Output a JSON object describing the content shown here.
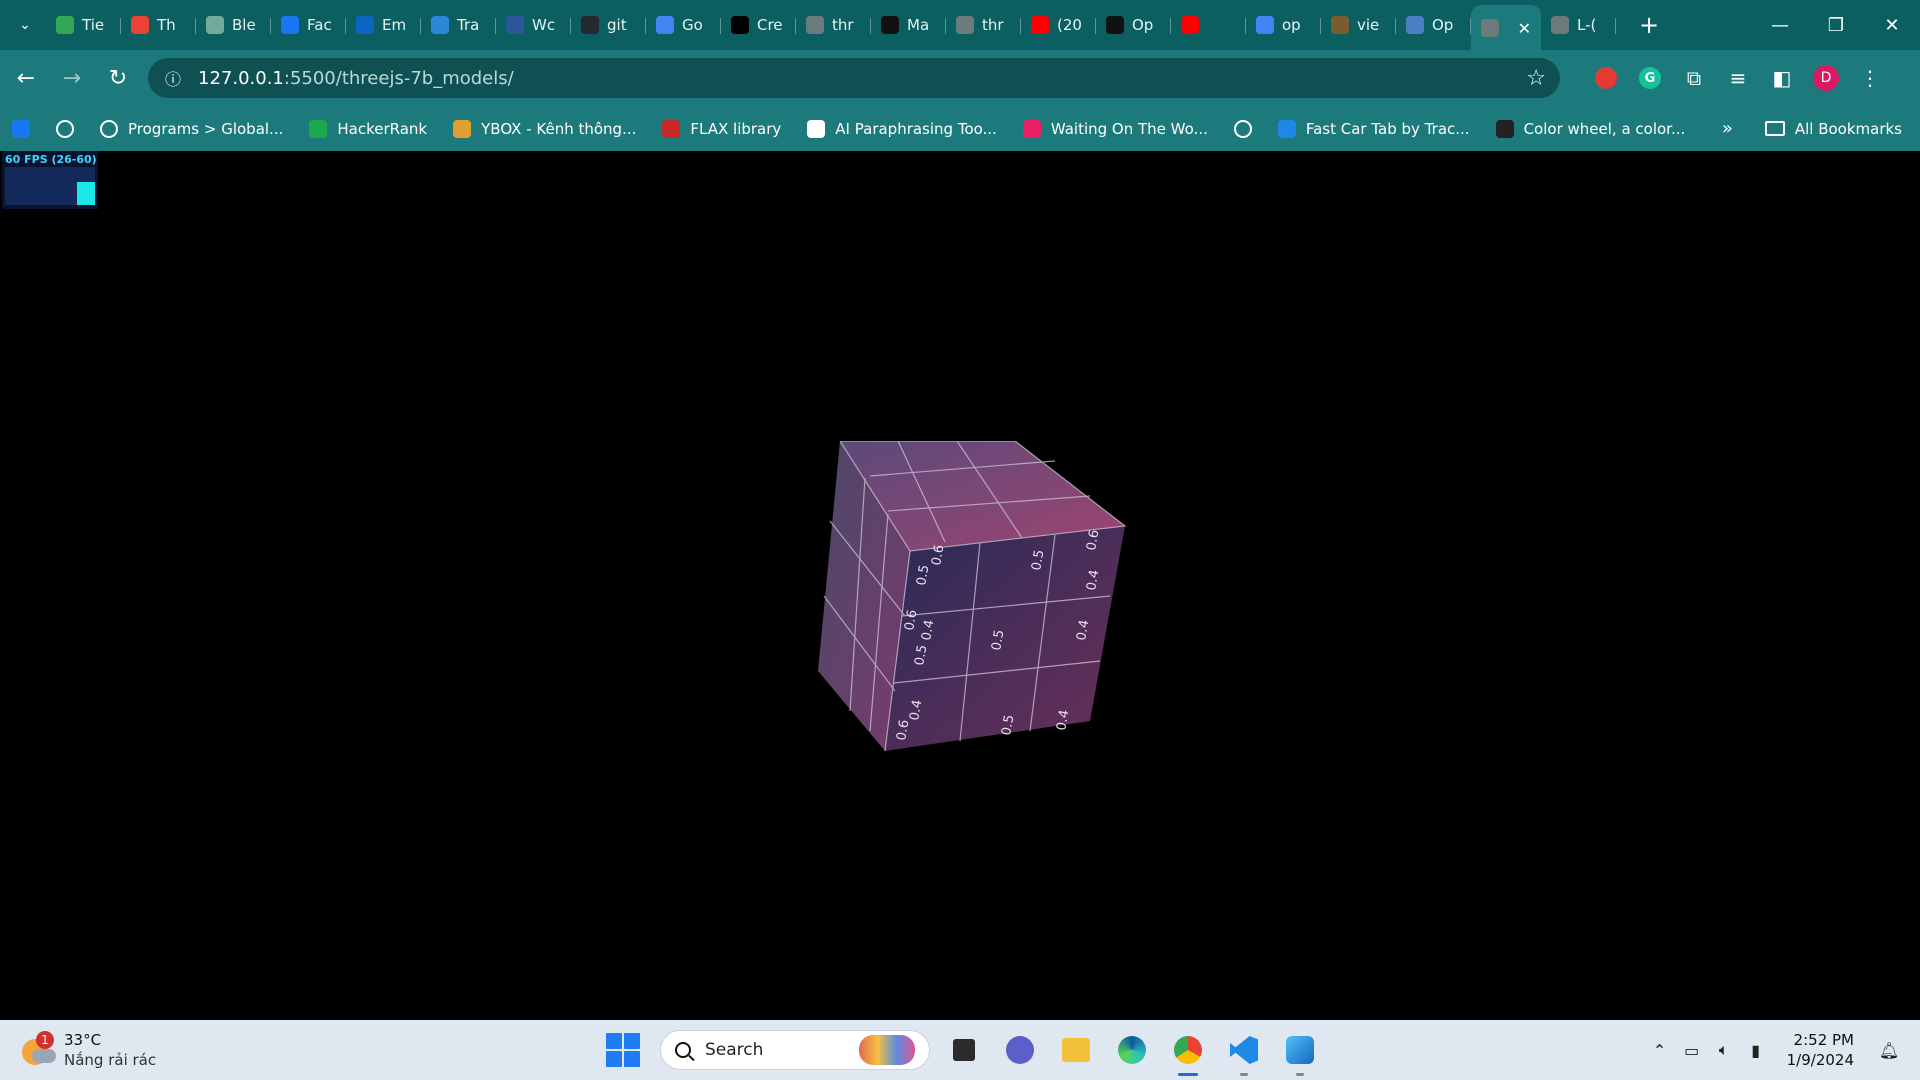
{
  "tabs": [
    {
      "title": "Tie",
      "color": "#34a853"
    },
    {
      "title": "Th",
      "color": "#ea4335"
    },
    {
      "title": "Ble",
      "color": "#74aa9c"
    },
    {
      "title": "Fac",
      "color": "#1877f2"
    },
    {
      "title": "Em",
      "color": "#0a66c2"
    },
    {
      "title": "Tra",
      "color": "#2b88d8"
    },
    {
      "title": "Wc",
      "color": "#2b579a"
    },
    {
      "title": "git",
      "color": "#24292f"
    },
    {
      "title": "Go",
      "color": "#4285f4"
    },
    {
      "title": "Cre",
      "color": "#000000"
    },
    {
      "title": "thr",
      "color": "#6b7b7b"
    },
    {
      "title": "Ma",
      "color": "#111111"
    },
    {
      "title": "thr",
      "color": "#6b7b7b"
    },
    {
      "title": "(20",
      "color": "#ff0000"
    },
    {
      "title": "Op",
      "color": "#111111"
    },
    {
      "title": "",
      "color": "#ff0000"
    },
    {
      "title": "op",
      "color": "#4285f4"
    },
    {
      "title": "vie",
      "color": "#7a5c2e"
    },
    {
      "title": "Op",
      "color": "#4a7fc1"
    },
    {
      "title": "",
      "color": "#6b7b7b"
    },
    {
      "title": "L-(",
      "color": "#6b7b7b"
    }
  ],
  "active_tab_index": 19,
  "toolbar": {
    "url_host": "127.0.0.1",
    "url_path": ":5500/threejs-7b_models/",
    "avatar_letter": "D"
  },
  "bookmarks": [
    {
      "label": "",
      "icon": "facebook-icon",
      "color": "#1877f2"
    },
    {
      "label": "",
      "icon": "globe-icon",
      "color": "#ffffff"
    },
    {
      "label": "Programs > Global...",
      "icon": "globe-icon",
      "color": "#ffffff"
    },
    {
      "label": "HackerRank",
      "icon": "hackerrank-icon",
      "color": "#1ba94c"
    },
    {
      "label": "YBOX - Kênh thông...",
      "icon": "ybox-icon",
      "color": "#e0a030"
    },
    {
      "label": "FLAX library",
      "icon": "flax-icon",
      "color": "#c62828"
    },
    {
      "label": "AI Paraphrasing Too...",
      "icon": "quill-icon",
      "color": "#ffffff"
    },
    {
      "label": "Waiting On The Wo...",
      "icon": "goodreads-icon",
      "color": "#e91e63"
    },
    {
      "label": "",
      "icon": "globe-icon",
      "color": "#ffffff"
    },
    {
      "label": "Fast Car Tab by Trac...",
      "icon": "car-icon",
      "color": "#1e88e5"
    },
    {
      "label": "Color wheel, a color...",
      "icon": "color-wheel-icon",
      "color": "#222222"
    }
  ],
  "all_bookmarks_label": "All Bookmarks",
  "fps": {
    "label": "60 FPS (26-60)",
    "level": 0.6
  },
  "cube": {
    "labels": [
      "0.6",
      "0.5",
      "0.4",
      "0.6",
      "0.5",
      "0.4",
      "0.5",
      "0.5",
      "0.6",
      "0.4",
      "0.4",
      "0.6",
      "0.5",
      "0.4"
    ]
  },
  "taskbar": {
    "weather_temp": "33°C",
    "weather_desc": "Nắng rải rác",
    "weather_badge": "1",
    "search_placeholder": "Search",
    "time": "2:52 PM",
    "date": "1/9/2024"
  }
}
